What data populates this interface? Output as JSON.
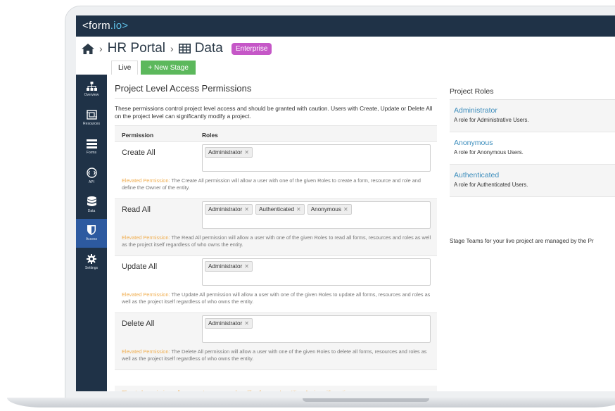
{
  "app": {
    "logo_left": "<",
    "logo_brand": "form",
    "logo_mid": ".",
    "logo_tail": "io>"
  },
  "breadcrumb": {
    "project": "HR Portal",
    "section": "Data",
    "badge": "Enterprise"
  },
  "tabs": [
    {
      "label": "Live"
    },
    {
      "label": "+ New Stage"
    }
  ],
  "sidebar": {
    "items": [
      {
        "label": "Overview",
        "icon": "sitemap-icon"
      },
      {
        "label": "Resources",
        "icon": "resources-icon"
      },
      {
        "label": "Forms",
        "icon": "forms-icon"
      },
      {
        "label": "API",
        "icon": "api-icon"
      },
      {
        "label": "Data",
        "icon": "database-icon"
      },
      {
        "label": "Access",
        "icon": "shield-icon"
      },
      {
        "label": "Settings",
        "icon": "gear-icon"
      }
    ],
    "active": "Access"
  },
  "main": {
    "title": "Project Level Access Permissions",
    "description": "These permissions control project level access and should be granted with caution. Users with Create, Update or Delete All on the project level can significantly modify a project.",
    "col_permission": "Permission",
    "col_roles": "Roles",
    "permissions": [
      {
        "name": "Create All",
        "roles": [
          "Administrator"
        ],
        "warn_label": "Elevated Permission:",
        "warn_text": " The Create All permission will allow a user with one of the given Roles to create a form, resource and role and define the Owner of the entity."
      },
      {
        "name": "Read All",
        "roles": [
          "Administrator",
          "Authenticated",
          "Anonymous"
        ],
        "warn_label": "Elevated Permission:",
        "warn_text": " The Read All permission will allow a user with one of the given Roles to read all forms, resources and roles as well as the project itself regardless of who owns the entity."
      },
      {
        "name": "Update All",
        "roles": [
          "Administrator"
        ],
        "warn_label": "Elevated Permission:",
        "warn_text": " The Update All permission will allow a user with one of the given Roles to update all forms, resources and roles as well as the project itself regardless of who owns the entity."
      },
      {
        "name": "Delete All",
        "roles": [
          "Administrator"
        ],
        "warn_label": "Elevated Permission:",
        "warn_text": " The Delete All permission will allow a user with one of the given Roles to delete all forms, resources and roles as well as the project itself regardless of who owns the entity."
      }
    ],
    "footer_note": "Elevated permissions allow users to access and modify other user's entities. Assign with caution."
  },
  "right": {
    "title": "Project Roles",
    "roles": [
      {
        "name": "Administrator",
        "desc": "A role for Administrative Users."
      },
      {
        "name": "Anonymous",
        "desc": "A role for Anonymous Users."
      },
      {
        "name": "Authenticated",
        "desc": "A role for Authenticated Users."
      }
    ],
    "teams_note": "Stage Teams for your live project are managed by the Pr"
  },
  "colors": {
    "nav_bg": "#1f3247",
    "active_nav": "#2d5aa0",
    "badge": "#c557c7",
    "new_stage": "#5cb85c",
    "warning": "#f0ad4e",
    "link": "#3c8dbc"
  }
}
